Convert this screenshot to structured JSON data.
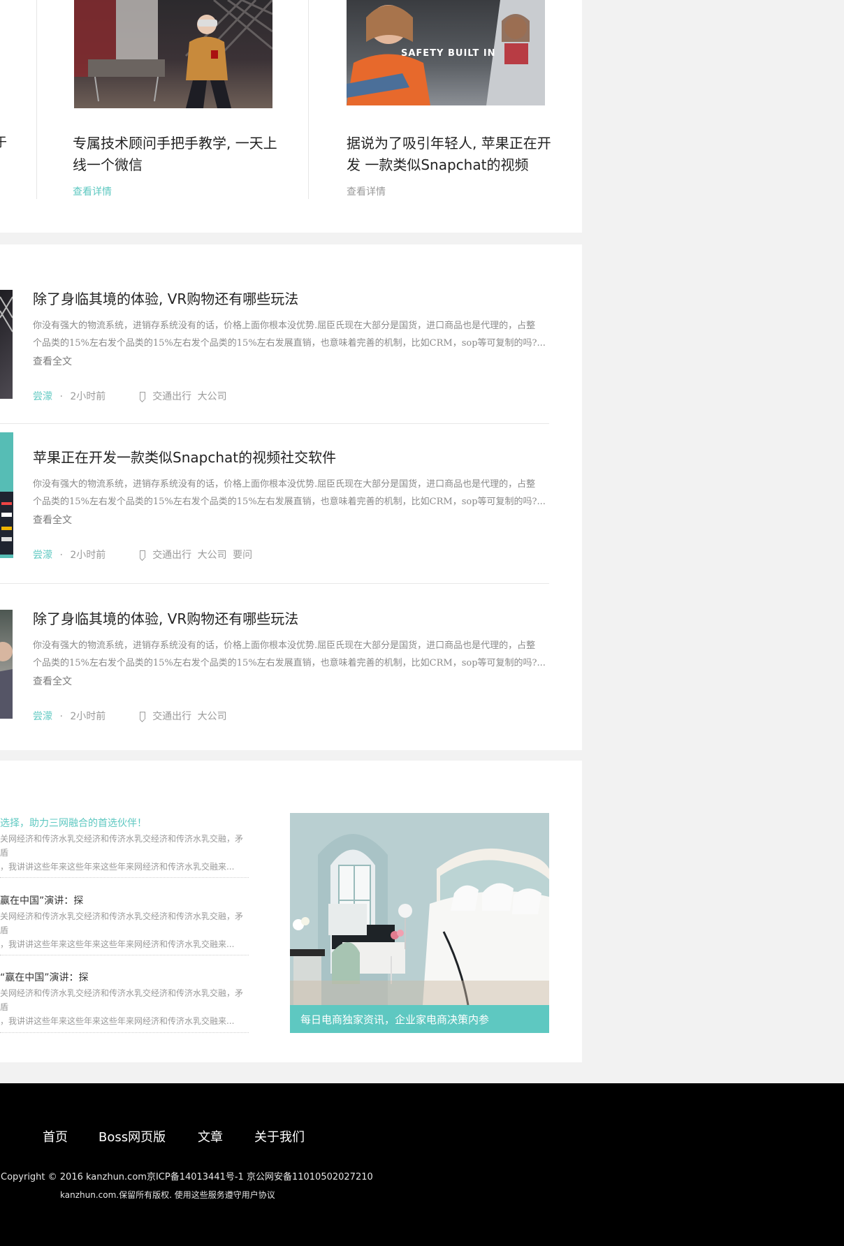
{
  "top_cards": [
    {
      "title_line1": "专属技术顾问手把手教学, 一天上",
      "title_line2": "线一个微信",
      "link": "查看详情",
      "link_color": "#5ec8c1"
    },
    {
      "title_line1": "据说为了吸引年轻人, 苹果正在开",
      "title_line2": "发 一款类似Snapchat的视频",
      "link": "查看详情",
      "link_color": "#9a9a9a",
      "image_overlay": "SAFETY BUILT IN"
    }
  ],
  "left_edge_text": "于",
  "articles": [
    {
      "title": "除了身临其境的体验, VR购物还有哪些玩法",
      "excerpt_line1": "你没有强大的物流系统，进销存系统没有的话，价格上面你根本没优势.屈臣氏现在大部分是国货，进口商品也是代理的，占整",
      "excerpt_line2": "个品类的15%左右发个品类的15%左右发个品类的15%左右发展直销，也意味着完善的机制，比如CRM，sop等可复制的吗?...",
      "read_more": "查看全文",
      "author": "尝濛",
      "dot": "·",
      "time": "2小时前",
      "tags": [
        "交通出行",
        "大公司"
      ]
    },
    {
      "title": "苹果正在开发一款类似Snapchat的视频社交软件",
      "excerpt_line1": "你没有强大的物流系统，进销存系统没有的话，价格上面你根本没优势.屈臣氏现在大部分是国货，进口商品也是代理的，占整",
      "excerpt_line2": "个品类的15%左右发个品类的15%左右发个品类的15%左右发展直销，也意味着完善的机制，比如CRM，sop等可复制的吗?...",
      "read_more": "查看全文",
      "author": "尝濛",
      "dot": "·",
      "time": "2小时前",
      "tags": [
        "交通出行",
        "大公司",
        "要问"
      ]
    },
    {
      "title": "除了身临其境的体验, VR购物还有哪些玩法",
      "excerpt_line1": "你没有强大的物流系统，进销存系统没有的话，价格上面你根本没优势.屈臣氏现在大部分是国货，进口商品也是代理的，占整",
      "excerpt_line2": "个品类的15%左右发个品类的15%左右发个品类的15%左右发展直销，也意味着完善的机制，比如CRM，sop等可复制的吗?...",
      "read_more": "查看全文",
      "author": "尝濛",
      "dot": "·",
      "time": "2小时前",
      "tags": [
        "交通出行",
        "大公司"
      ]
    }
  ],
  "side_list": [
    {
      "title": "选择，助力三网融合的首选伙伴！",
      "highlight": true,
      "line1": "关网经济和传济水乳交经济和传济水乳交经济和传济水乳交融，矛盾",
      "line2": "，我讲讲这些年来这些年来这些年来网经济和传济水乳交融来..."
    },
    {
      "title": "赢在中国”演讲：探",
      "highlight": false,
      "line1": "关网经济和传济水乳交经济和传济水乳交经济和传济水乳交融，矛盾",
      "line2": "，我讲讲这些年来这些年来这些年来网经济和传济水乳交融来..."
    },
    {
      "title": "“赢在中国”演讲：探",
      "highlight": false,
      "line1": "关网经济和传济水乳交经济和传济水乳交经济和传济水乳交融，矛盾",
      "line2": "，我讲讲这些年来这些年来这些年来网经济和传济水乳交融来..."
    }
  ],
  "feature_caption": "每日电商独家资讯，企业家电商决策内参",
  "footer": {
    "links": [
      "首页",
      "Boss网页版",
      "文章",
      "关于我们"
    ],
    "copyright": "Copyright © 2016 kanzhun.com京ICP备14013441号-1 京公网安备11010502027210",
    "rights": "kanzhun.com.保留所有版权. 使用这些服务遵守用户协议"
  },
  "colors": {
    "accent": "#5ec8c1",
    "background": "#f2f2f2",
    "footer": "#000000"
  }
}
